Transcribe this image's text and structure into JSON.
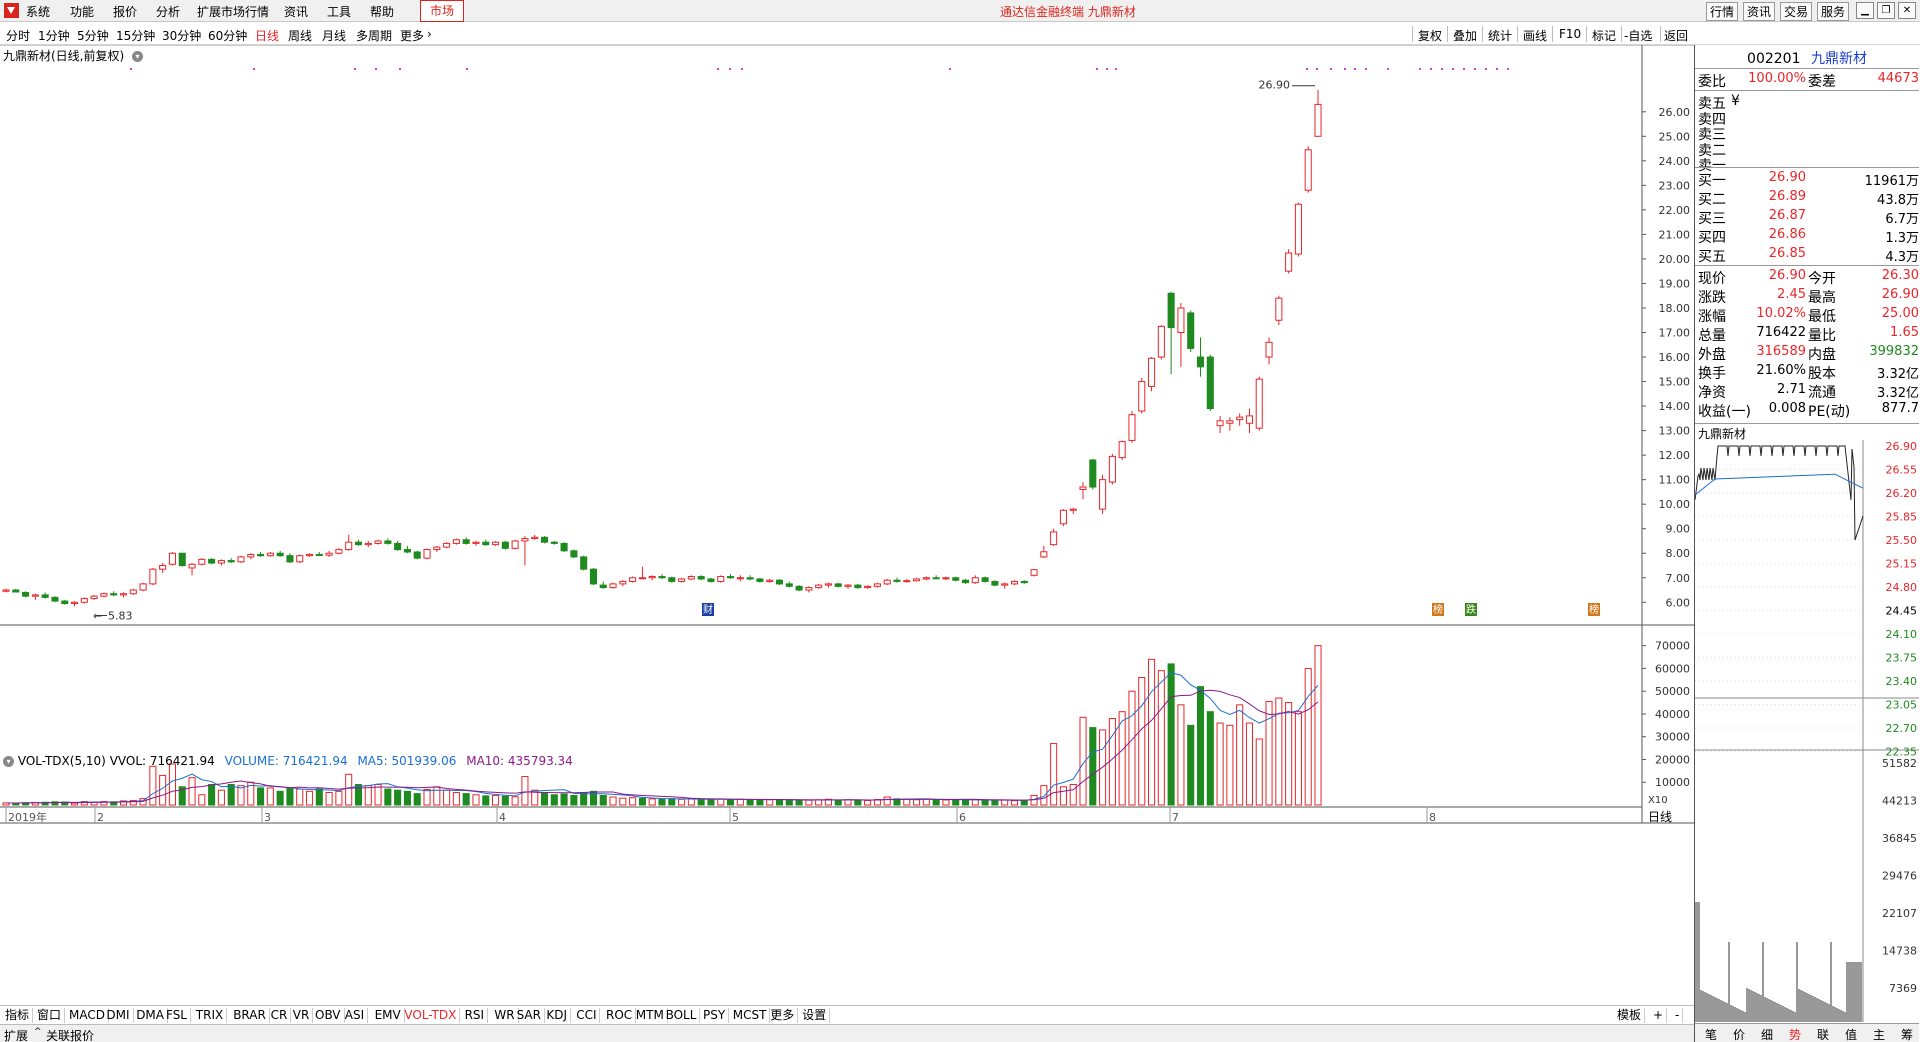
{
  "menu": {
    "items": [
      "系统",
      "功能",
      "报价",
      "分析",
      "扩展市场行情",
      "资讯",
      "工具",
      "帮助"
    ],
    "market": "市场",
    "app_title": "通达信金融终端  九鼎新材",
    "right_buttons": [
      "行情",
      "资讯",
      "交易",
      "服务"
    ]
  },
  "periods": {
    "items": [
      "分时",
      "1分钟",
      "5分钟",
      "15分钟",
      "30分钟",
      "60分钟",
      "日线",
      "周线",
      "月线",
      "多周期",
      "更多"
    ],
    "active": "日线"
  },
  "toolbar": {
    "items": [
      "复权",
      "叠加",
      "统计",
      "画线",
      "F10",
      "标记",
      "-自选",
      "返回"
    ]
  },
  "chart_title": "九鼎新材(日线,前复权)",
  "indicator_title": {
    "name": "VOL-TDX(5,10)",
    "vvol": "VVOL: 716421.94",
    "volume": "VOLUME: 716421.94",
    "ma5": "MA5: 501939.06",
    "ma10": "MA10: 435793.34"
  },
  "x10_label": "X10",
  "price_axis": [
    "26.00",
    "25.00",
    "24.00",
    "23.00",
    "22.00",
    "21.00",
    "20.00",
    "19.00",
    "18.00",
    "17.00",
    "16.00",
    "15.00",
    "14.00",
    "13.00",
    "12.00",
    "11.00",
    "10.00",
    "9.00",
    "8.00",
    "7.00",
    "6.00"
  ],
  "vol_axis": [
    "70000",
    "60000",
    "50000",
    "40000",
    "30000",
    "20000",
    "10000"
  ],
  "date_axis": [
    "2019年",
    "2",
    "3",
    "4",
    "5",
    "6",
    "7",
    "8"
  ],
  "labels": {
    "high_mark": "26.90",
    "low_mark": "5.83",
    "marker_cai": "财",
    "marker_bang1": "榜",
    "marker_bang2": "榜",
    "marker_zhang": "跌"
  },
  "chart_data": {
    "type": "candlestick",
    "title": "九鼎新材(日线,前复权)",
    "y_range": [
      5.4,
      27.5
    ],
    "candles_note": "daily OHLC values approximated from chart",
    "candles": [
      [
        6.45,
        6.55,
        6.4,
        6.5
      ],
      [
        6.5,
        6.55,
        6.4,
        6.42
      ],
      [
        6.4,
        6.45,
        6.2,
        6.25
      ],
      [
        6.25,
        6.35,
        6.1,
        6.3
      ],
      [
        6.3,
        6.4,
        6.15,
        6.2
      ],
      [
        6.2,
        6.25,
        6.0,
        6.05
      ],
      [
        6.05,
        6.1,
        5.9,
        5.95
      ],
      [
        5.95,
        6.05,
        5.83,
        6.0
      ],
      [
        6.0,
        6.2,
        5.95,
        6.15
      ],
      [
        6.15,
        6.3,
        6.1,
        6.25
      ],
      [
        6.25,
        6.4,
        6.2,
        6.35
      ],
      [
        6.35,
        6.45,
        6.25,
        6.3
      ],
      [
        6.3,
        6.4,
        6.2,
        6.35
      ],
      [
        6.35,
        6.55,
        6.3,
        6.5
      ],
      [
        6.5,
        6.8,
        6.45,
        6.75
      ],
      [
        6.75,
        7.4,
        6.7,
        7.35
      ],
      [
        7.35,
        7.6,
        7.2,
        7.5
      ],
      [
        7.55,
        8.05,
        7.5,
        8.0
      ],
      [
        8.0,
        8.0,
        7.45,
        7.5
      ],
      [
        7.4,
        7.6,
        7.1,
        7.55
      ],
      [
        7.55,
        7.8,
        7.5,
        7.75
      ],
      [
        7.75,
        7.8,
        7.55,
        7.6
      ],
      [
        7.6,
        7.75,
        7.5,
        7.7
      ],
      [
        7.7,
        7.8,
        7.6,
        7.65
      ],
      [
        7.65,
        7.9,
        7.6,
        7.85
      ],
      [
        7.85,
        8.0,
        7.75,
        7.95
      ],
      [
        7.95,
        8.05,
        7.85,
        7.9
      ],
      [
        7.9,
        8.05,
        7.85,
        8.0
      ],
      [
        8.0,
        8.1,
        7.85,
        7.9
      ],
      [
        7.9,
        8.0,
        7.6,
        7.65
      ],
      [
        7.65,
        7.95,
        7.6,
        7.9
      ],
      [
        7.9,
        8.0,
        7.85,
        7.95
      ],
      [
        7.95,
        8.05,
        7.9,
        7.92
      ],
      [
        7.92,
        8.1,
        7.85,
        8.0
      ],
      [
        8.0,
        8.2,
        7.95,
        8.15
      ],
      [
        8.15,
        8.75,
        8.1,
        8.45
      ],
      [
        8.45,
        8.55,
        8.3,
        8.35
      ],
      [
        8.35,
        8.5,
        8.25,
        8.4
      ],
      [
        8.4,
        8.55,
        8.35,
        8.5
      ],
      [
        8.5,
        8.6,
        8.35,
        8.4
      ],
      [
        8.4,
        8.5,
        8.1,
        8.15
      ],
      [
        8.15,
        8.3,
        8.0,
        8.05
      ],
      [
        8.05,
        8.1,
        7.75,
        7.8
      ],
      [
        7.8,
        8.2,
        7.75,
        8.15
      ],
      [
        8.15,
        8.3,
        8.05,
        8.25
      ],
      [
        8.25,
        8.45,
        8.2,
        8.4
      ],
      [
        8.4,
        8.6,
        8.35,
        8.55
      ],
      [
        8.55,
        8.65,
        8.35,
        8.4
      ],
      [
        8.4,
        8.5,
        8.3,
        8.45
      ],
      [
        8.45,
        8.55,
        8.3,
        8.35
      ],
      [
        8.35,
        8.5,
        8.3,
        8.45
      ],
      [
        8.45,
        8.5,
        8.15,
        8.2
      ],
      [
        8.2,
        8.55,
        8.15,
        8.5
      ],
      [
        8.5,
        8.7,
        7.5,
        8.6
      ],
      [
        8.6,
        8.75,
        8.55,
        8.65
      ],
      [
        8.65,
        8.7,
        8.4,
        8.45
      ],
      [
        8.45,
        8.5,
        8.35,
        8.4
      ],
      [
        8.4,
        8.45,
        8.05,
        8.1
      ],
      [
        8.1,
        8.15,
        7.8,
        7.85
      ],
      [
        7.85,
        7.9,
        7.3,
        7.35
      ],
      [
        7.35,
        7.4,
        6.7,
        6.75
      ],
      [
        6.7,
        6.85,
        6.55,
        6.6
      ],
      [
        6.6,
        6.8,
        6.55,
        6.75
      ],
      [
        6.75,
        6.9,
        6.65,
        6.85
      ],
      [
        6.85,
        7.05,
        6.8,
        7.0
      ],
      [
        7.0,
        7.45,
        6.95,
        7.0
      ],
      [
        7.0,
        7.1,
        6.9,
        7.05
      ],
      [
        7.05,
        7.15,
        6.95,
        7.0
      ],
      [
        7.0,
        7.05,
        6.8,
        6.85
      ],
      [
        6.85,
        7.0,
        6.8,
        6.95
      ],
      [
        6.95,
        7.1,
        6.9,
        7.05
      ],
      [
        7.05,
        7.1,
        6.9,
        6.95
      ],
      [
        6.95,
        7.0,
        6.8,
        6.85
      ],
      [
        6.85,
        7.1,
        6.8,
        7.05
      ],
      [
        7.05,
        7.15,
        6.95,
        7.0
      ],
      [
        7.0,
        7.1,
        6.85,
        7.0
      ],
      [
        7.0,
        7.1,
        6.9,
        6.95
      ],
      [
        6.95,
        7.0,
        6.8,
        6.85
      ],
      [
        6.85,
        6.95,
        6.8,
        6.9
      ],
      [
        6.9,
        6.95,
        6.7,
        6.75
      ],
      [
        6.75,
        6.85,
        6.6,
        6.65
      ],
      [
        6.65,
        6.7,
        6.45,
        6.5
      ],
      [
        6.5,
        6.65,
        6.4,
        6.6
      ],
      [
        6.6,
        6.75,
        6.55,
        6.7
      ],
      [
        6.7,
        6.8,
        6.6,
        6.75
      ],
      [
        6.75,
        6.8,
        6.6,
        6.65
      ],
      [
        6.65,
        6.75,
        6.55,
        6.7
      ],
      [
        6.7,
        6.75,
        6.55,
        6.6
      ],
      [
        6.6,
        6.7,
        6.55,
        6.65
      ],
      [
        6.65,
        6.8,
        6.6,
        6.75
      ],
      [
        6.75,
        6.95,
        6.7,
        6.9
      ],
      [
        6.9,
        7.0,
        6.8,
        6.85
      ],
      [
        6.85,
        6.95,
        6.8,
        6.88
      ],
      [
        6.88,
        7.0,
        6.85,
        6.95
      ],
      [
        6.95,
        7.05,
        6.9,
        7.0
      ],
      [
        7.0,
        7.1,
        6.95,
        6.98
      ],
      [
        6.98,
        7.05,
        6.9,
        7.0
      ],
      [
        7.0,
        7.05,
        6.85,
        6.9
      ],
      [
        6.9,
        6.95,
        6.75,
        6.8
      ],
      [
        6.8,
        7.1,
        6.75,
        7.0
      ],
      [
        7.0,
        7.05,
        6.8,
        6.85
      ],
      [
        6.85,
        6.9,
        6.65,
        6.7
      ],
      [
        6.7,
        6.8,
        6.55,
        6.75
      ],
      [
        6.75,
        6.9,
        6.7,
        6.85
      ],
      [
        6.85,
        6.9,
        6.75,
        6.8
      ],
      [
        7.1,
        7.35,
        7.05,
        7.33
      ],
      [
        7.85,
        8.3,
        7.8,
        8.06
      ],
      [
        8.35,
        9.0,
        8.3,
        8.87
      ],
      [
        9.2,
        9.8,
        9.1,
        9.75
      ],
      [
        9.75,
        9.85,
        9.6,
        9.8
      ],
      [
        10.6,
        10.9,
        10.2,
        10.7
      ],
      [
        11.8,
        11.85,
        10.6,
        10.7
      ],
      [
        9.8,
        11.2,
        9.6,
        11.0
      ],
      [
        10.9,
        12.05,
        10.8,
        11.95
      ],
      [
        11.9,
        12.6,
        11.8,
        12.55
      ],
      [
        12.6,
        13.8,
        12.5,
        13.65
      ],
      [
        13.8,
        15.15,
        13.7,
        15.0
      ],
      [
        14.8,
        16.0,
        14.6,
        15.95
      ],
      [
        16.0,
        17.3,
        15.9,
        17.25
      ],
      [
        18.6,
        18.65,
        15.3,
        17.2
      ],
      [
        17.0,
        18.2,
        15.6,
        18.0
      ],
      [
        17.8,
        17.9,
        16.2,
        16.35
      ],
      [
        16.0,
        16.8,
        15.2,
        15.6
      ],
      [
        16.0,
        16.1,
        13.8,
        13.9
      ],
      [
        13.2,
        13.6,
        12.9,
        13.4
      ],
      [
        13.3,
        13.55,
        13.0,
        13.4
      ],
      [
        13.45,
        13.7,
        13.2,
        13.55
      ],
      [
        13.3,
        13.9,
        12.9,
        13.6
      ],
      [
        13.1,
        15.2,
        13.0,
        15.1
      ],
      [
        16.0,
        16.8,
        15.7,
        16.6
      ],
      [
        17.5,
        18.5,
        17.3,
        18.4
      ],
      [
        19.5,
        20.4,
        19.4,
        20.24
      ],
      [
        20.2,
        22.3,
        20.1,
        22.23
      ],
      [
        22.8,
        24.6,
        22.7,
        24.45
      ],
      [
        25.0,
        26.9,
        25.0,
        26.3
      ]
    ],
    "volume": [
      900,
      850,
      1000,
      1100,
      1200,
      1400,
      1300,
      800,
      1500,
      1300,
      1500,
      1400,
      1800,
      2000,
      2800,
      17000,
      13000,
      18000,
      8000,
      12000,
      4500,
      9000,
      6500,
      9000,
      8500,
      10000,
      7500,
      7500,
      6000,
      7500,
      7000,
      6000,
      7000,
      5500,
      6000,
      13500,
      9000,
      8500,
      9000,
      7000,
      6500,
      6000,
      5000,
      6800,
      8000,
      6500,
      5500,
      5000,
      4500,
      4000,
      4200,
      3800,
      3600,
      12500,
      6500,
      5500,
      4500,
      4800,
      4200,
      5500,
      6000,
      4200,
      3500,
      3000,
      3200,
      2900,
      2700,
      2600,
      2700,
      2500,
      2600,
      2500,
      2400,
      2600,
      2300,
      2500,
      2200,
      2400,
      2300,
      2400,
      2200,
      2000,
      2100,
      2300,
      2500,
      2200,
      2300,
      2100,
      2000,
      2400,
      3500,
      2700,
      2500,
      2300,
      2600,
      2400,
      2200,
      2300,
      2100,
      2300,
      2100,
      2000,
      2200,
      1900,
      2000,
      4200,
      8500,
      27000,
      8000,
      9000,
      38500,
      34000,
      33000,
      38000,
      41000,
      50000,
      56000,
      64000,
      59000,
      62000,
      44000,
      35000,
      52000,
      41000,
      36000,
      35000,
      44000,
      36000,
      29000,
      45500,
      47000,
      45000,
      41000,
      60000,
      70000
    ],
    "volume_up": [
      true,
      false,
      false,
      true,
      false,
      false,
      false,
      true,
      true,
      true,
      true,
      false,
      true,
      true,
      true,
      true,
      true,
      true,
      false,
      true,
      true,
      false,
      true,
      false,
      true,
      true,
      false,
      true,
      false,
      false,
      true,
      true,
      false,
      true,
      true,
      true,
      false,
      true,
      true,
      false,
      false,
      false,
      false,
      true,
      true,
      true,
      true,
      false,
      true,
      false,
      true,
      false,
      true,
      true,
      true,
      false,
      false,
      false,
      false,
      false,
      false,
      false,
      true,
      true,
      true,
      false,
      true,
      false,
      false,
      true,
      true,
      false,
      false,
      true,
      false,
      true,
      false,
      false,
      true,
      false,
      false,
      false,
      true,
      true,
      true,
      false,
      true,
      false,
      true,
      true,
      true,
      false,
      true,
      true,
      true,
      false,
      true,
      false,
      false,
      true,
      false,
      false,
      true,
      true,
      false,
      true,
      true,
      true,
      true,
      true,
      true,
      false,
      true,
      true,
      true,
      true,
      true,
      true,
      true,
      false,
      true,
      false,
      false,
      false,
      true,
      true,
      true,
      true,
      true,
      true,
      true,
      true,
      true,
      true,
      true
    ]
  },
  "quote": {
    "code": "002201",
    "name": "九鼎新材",
    "weibi_label": "委比",
    "weibi_value": "100.00%",
    "weicha_label": "委差",
    "weicha_value": "44673",
    "asks": [
      {
        "label": "卖五",
        "price": "¥",
        "vol": ""
      },
      {
        "label": "卖四",
        "price": "",
        "vol": ""
      },
      {
        "label": "卖三",
        "price": "",
        "vol": ""
      },
      {
        "label": "卖二",
        "price": "",
        "vol": ""
      },
      {
        "label": "卖一",
        "price": "",
        "vol": ""
      }
    ],
    "bids": [
      {
        "label": "买一",
        "price": "26.90",
        "vol": "11961万"
      },
      {
        "label": "买二",
        "price": "26.89",
        "vol": "43.8万"
      },
      {
        "label": "买三",
        "price": "26.87",
        "vol": "6.7万"
      },
      {
        "label": "买四",
        "price": "26.86",
        "vol": "1.3万"
      },
      {
        "label": "买五",
        "price": "26.85",
        "vol": "4.3万"
      }
    ],
    "stats": [
      {
        "l1": "现价",
        "v1": "26.90",
        "c1": "red",
        "l2": "今开",
        "v2": "26.30",
        "c2": "red"
      },
      {
        "l1": "涨跌",
        "v1": "2.45",
        "c1": "red",
        "l2": "最高",
        "v2": "26.90",
        "c2": "red"
      },
      {
        "l1": "涨幅",
        "v1": "10.02%",
        "c1": "red",
        "l2": "最低",
        "v2": "25.00",
        "c2": "red"
      },
      {
        "l1": "总量",
        "v1": "716422",
        "c1": "",
        "l2": "量比",
        "v2": "1.65",
        "c2": "red"
      },
      {
        "l1": "外盘",
        "v1": "316589",
        "c1": "red",
        "l2": "内盘",
        "v2": "399832",
        "c2": "green"
      },
      {
        "l1": "换手",
        "v1": "21.60%",
        "c1": "",
        "l2": "股本",
        "v2": "3.32亿",
        "c2": ""
      },
      {
        "l1": "净资",
        "v1": "2.71",
        "c1": "",
        "l2": "流通",
        "v2": "3.32亿",
        "c2": ""
      },
      {
        "l1": "收益(一)",
        "v1": "0.008",
        "c1": "",
        "l2": "PE(动)",
        "v2": "877.7",
        "c2": ""
      }
    ],
    "mini_title": "九鼎新材",
    "mini_axis": [
      "26.90",
      "26.55",
      "26.20",
      "25.85",
      "25.50",
      "25.15",
      "24.80",
      "24.45",
      "24.10",
      "23.75",
      "23.40",
      "23.05",
      "22.70",
      "22.35"
    ],
    "mini_vol_axis": [
      "51582",
      "44213",
      "36845",
      "29476",
      "22107",
      "14738",
      "7369"
    ],
    "tabs": [
      "笔",
      "价",
      "细",
      "势",
      "联",
      "值",
      "主",
      "筹"
    ],
    "active_tab": "势"
  },
  "bottom": {
    "items": [
      "指标",
      "窗口",
      "MACD",
      "DMI",
      "DMA",
      "FSL",
      "TRIX",
      "BRAR",
      "CR",
      "VR",
      "OBV",
      "ASI",
      "EMV",
      "VOL-TDX",
      "RSI",
      "WR",
      "SAR",
      "KDJ",
      "CCI",
      "ROC",
      "MTM",
      "BOLL",
      "PSY",
      "MCST",
      "更多",
      "设置"
    ],
    "active": "VOL-TDX",
    "right_items": [
      "模板",
      "+",
      "-"
    ],
    "status": [
      "扩展",
      "关联报价"
    ]
  },
  "colors": {
    "up": "#e8262a",
    "down": "#1f8a1f",
    "ma5": "#1b6fd1",
    "ma10": "#8b1a8b"
  }
}
